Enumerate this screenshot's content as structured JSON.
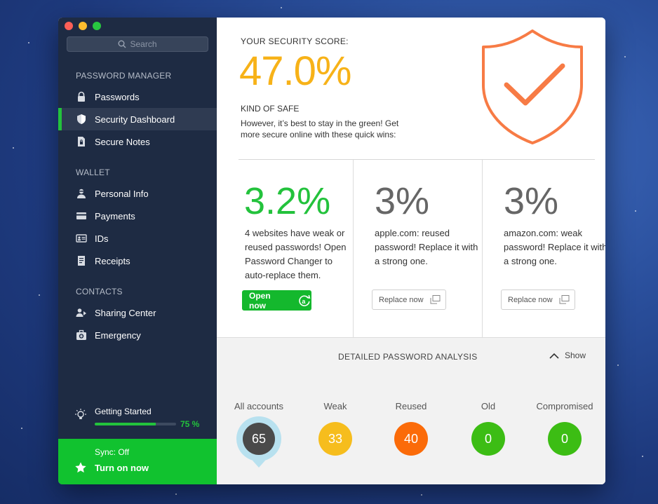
{
  "window": {
    "search_placeholder": "Search"
  },
  "sidebar": {
    "section_password_manager": "PASSWORD MANAGER",
    "section_wallet": "WALLET",
    "section_contacts": "CONTACTS",
    "items": [
      {
        "label": "Passwords",
        "icon": "lock-icon"
      },
      {
        "label": "Security Dashboard",
        "icon": "shield-icon",
        "active": true
      },
      {
        "label": "Secure Notes",
        "icon": "secure-note-icon"
      },
      {
        "label": "Personal Info",
        "icon": "person-icon"
      },
      {
        "label": "Payments",
        "icon": "credit-card-icon"
      },
      {
        "label": "IDs",
        "icon": "id-card-icon"
      },
      {
        "label": "Receipts",
        "icon": "receipt-icon"
      },
      {
        "label": "Sharing Center",
        "icon": "sharing-icon"
      },
      {
        "label": "Emergency",
        "icon": "emergency-kit-icon"
      }
    ],
    "getting_started": {
      "label": "Getting Started",
      "progress_percent": 75,
      "progress_text": "75 %"
    },
    "sync": {
      "status": "Sync: Off",
      "action": "Turn on now"
    }
  },
  "score": {
    "label": "YOUR SECURITY SCORE:",
    "value": "47.0%",
    "status": "KIND OF SAFE",
    "description": "However, it’s best to stay in the green! Get more secure online with these quick wins:"
  },
  "cards": [
    {
      "percent": "3.2%",
      "text": "4 websites have weak or reused passwords! Open Password Changer to auto-replace them.",
      "button": "Open now"
    },
    {
      "percent": "3%",
      "text": "apple.com: reused password! Replace it with a strong one.",
      "button": "Replace now"
    },
    {
      "percent": "3%",
      "text": "amazon.com: weak password! Replace it with a strong one.",
      "button": "Replace now"
    }
  ],
  "analysis": {
    "title": "DETAILED PASSWORD ANALYSIS",
    "toggle": "Show",
    "stats": [
      {
        "label": "All accounts",
        "value": "65",
        "color": "#4a4a4a"
      },
      {
        "label": "Weak",
        "value": "33",
        "color": "#f6bd1d"
      },
      {
        "label": "Reused",
        "value": "40",
        "color": "#fb6b09"
      },
      {
        "label": "Old",
        "value": "0",
        "color": "#3cbd14"
      },
      {
        "label": "Compromised",
        "value": "0",
        "color": "#3cbd14"
      }
    ]
  },
  "colors": {
    "accent_green": "#23c23c",
    "score_orange": "#f7b218",
    "shield_orange": "#f77b45",
    "sidebar_bg": "#1e2b43"
  }
}
